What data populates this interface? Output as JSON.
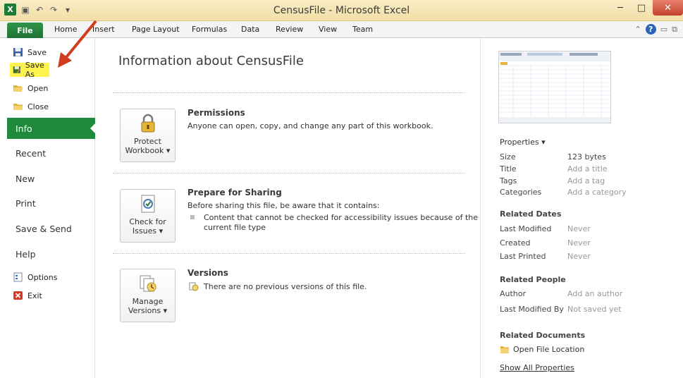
{
  "window": {
    "title": "CensusFile - Microsoft Excel",
    "app_icon_letter": "X"
  },
  "ribbon": {
    "file_tab": "File",
    "tabs": [
      "Home",
      "Insert",
      "Page Layout",
      "Formulas",
      "Data",
      "Review",
      "View",
      "Team"
    ]
  },
  "nav": {
    "save": "Save",
    "save_as": "Save As",
    "open": "Open",
    "close": "Close",
    "info": "Info",
    "recent": "Recent",
    "new": "New",
    "print": "Print",
    "save_send": "Save & Send",
    "help": "Help",
    "options": "Options",
    "exit": "Exit"
  },
  "main": {
    "title": "Information about CensusFile",
    "permissions": {
      "button_line1": "Protect",
      "button_line2": "Workbook",
      "title": "Permissions",
      "text": "Anyone can open, copy, and change any part of this workbook."
    },
    "sharing": {
      "button_line1": "Check for",
      "button_line2": "Issues",
      "title": "Prepare for Sharing",
      "text": "Before sharing this file, be aware that it contains:",
      "bullet_line1": "Content that cannot be checked for accessibility issues because of the",
      "bullet_line2": "current file type"
    },
    "versions": {
      "button_line1": "Manage",
      "button_line2": "Versions",
      "title": "Versions",
      "text": "There are no previous versions of this file."
    }
  },
  "properties": {
    "header": "Properties",
    "size_label": "Size",
    "size_value": "123 bytes",
    "title_label": "Title",
    "title_value": "Add a title",
    "tags_label": "Tags",
    "tags_value": "Add a tag",
    "categories_label": "Categories",
    "categories_value": "Add a category",
    "related_dates": "Related Dates",
    "last_modified_label": "Last Modified",
    "last_modified_value": "Never",
    "created_label": "Created",
    "created_value": "Never",
    "last_printed_label": "Last Printed",
    "last_printed_value": "Never",
    "related_people": "Related People",
    "author_label": "Author",
    "author_value": "Add an author",
    "last_modified_by_label": "Last Modified By",
    "last_modified_by_value": "Not saved yet",
    "related_documents": "Related Documents",
    "open_file_location": "Open File Location",
    "show_all_properties": "Show All Properties"
  },
  "colors": {
    "accent_green": "#1f8a3b",
    "highlight_yellow": "#fff44f",
    "annotation_red": "#d23b1e"
  }
}
